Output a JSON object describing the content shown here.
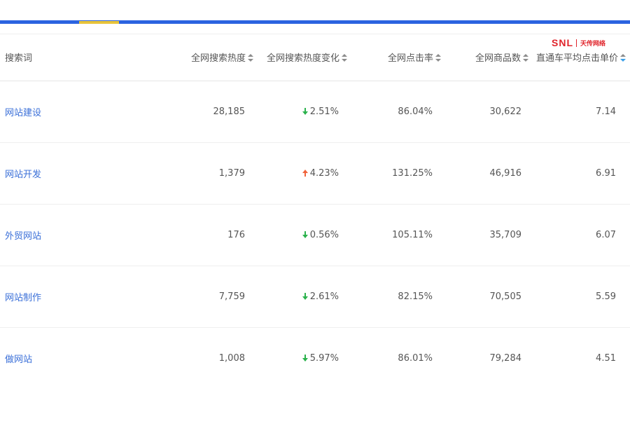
{
  "colors": {
    "topbar": "#2b63e0",
    "tab_indicator": "#e8c43a",
    "link": "#3a6fd8",
    "down": "#2bb24c",
    "up": "#f0643c",
    "logo": "#e0242b"
  },
  "logo": {
    "mark": "SNL",
    "text": "天传网络"
  },
  "table": {
    "headers": [
      "搜索词",
      "全网搜索热度",
      "全网搜索热度变化",
      "全网点击率",
      "全网商品数",
      "直通车平均点击单价"
    ],
    "rows": [
      {
        "keyword": "网站建设",
        "heat": "28,185",
        "change_dir": "down",
        "change": "2.51%",
        "ctr": "86.04%",
        "items": "30,622",
        "cpc": "7.14"
      },
      {
        "keyword": "网站开发",
        "heat": "1,379",
        "change_dir": "up",
        "change": "4.23%",
        "ctr": "131.25%",
        "items": "46,916",
        "cpc": "6.91"
      },
      {
        "keyword": "外贸网站",
        "heat": "176",
        "change_dir": "down",
        "change": "0.56%",
        "ctr": "105.11%",
        "items": "35,709",
        "cpc": "6.07"
      },
      {
        "keyword": "网站制作",
        "heat": "7,759",
        "change_dir": "down",
        "change": "2.61%",
        "ctr": "82.15%",
        "items": "70,505",
        "cpc": "5.59"
      },
      {
        "keyword": "做网站",
        "heat": "1,008",
        "change_dir": "down",
        "change": "5.97%",
        "ctr": "86.01%",
        "items": "79,284",
        "cpc": "4.51"
      }
    ]
  }
}
